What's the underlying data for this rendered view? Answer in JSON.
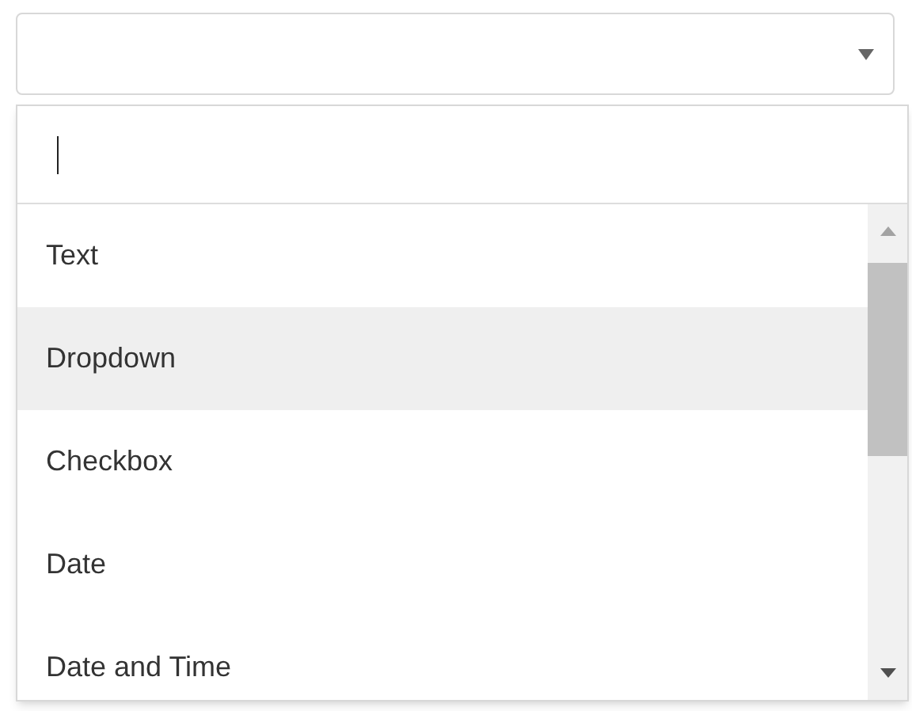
{
  "select": {
    "expanded": true
  },
  "options": [
    {
      "label": "Text",
      "highlighted": false
    },
    {
      "label": "Dropdown",
      "highlighted": true
    },
    {
      "label": "Checkbox",
      "highlighted": false
    },
    {
      "label": "Date",
      "highlighted": false
    },
    {
      "label": "Date and Time",
      "highlighted": false
    }
  ]
}
